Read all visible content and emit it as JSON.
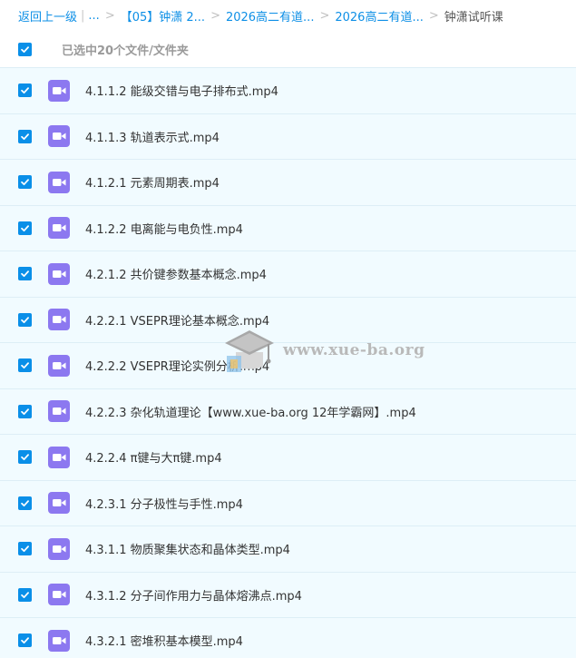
{
  "breadcrumb": {
    "back": "返回上一级",
    "pipe": "|",
    "ellipsis": "...",
    "sep": ">",
    "level1": "【05】钟潇 2...",
    "level2": "2026高二有道...",
    "level3": "2026高二有道...",
    "current": "钟潇试听课"
  },
  "selection": {
    "label": "已选中20个文件/文件夹"
  },
  "files": [
    "4.1.1.2 能级交错与电子排布式.mp4",
    "4.1.1.3 轨道表示式.mp4",
    "4.1.2.1 元素周期表.mp4",
    "4.1.2.2 电离能与电负性.mp4",
    "4.2.1.2 共价键参数基本概念.mp4",
    "4.2.2.1 VSEPR理论基本概念.mp4",
    "4.2.2.2 VSEPR理论实例分析.mp4",
    "4.2.2.3 杂化轨道理论【www.xue-ba.org 12年学霸网】.mp4",
    "4.2.2.4 π键与大π键.mp4",
    "4.2.3.1 分子极性与手性.mp4",
    "4.3.1.1 物质聚集状态和晶体类型.mp4",
    "4.3.1.2 分子间作用力与晶体熔沸点.mp4",
    "4.3.2.1 密堆积基本模型.mp4"
  ],
  "watermark": {
    "text": "www.xue-ba.org"
  },
  "colors": {
    "accent": "#0a8fe8",
    "link": "#0d8fe6",
    "row_bg": "#f1fbff",
    "video_icon": "#8c78f0"
  },
  "icons": {
    "checkbox": "checkmark-icon",
    "file": "video-file-icon",
    "watermark": "graduation-cap-icon"
  }
}
